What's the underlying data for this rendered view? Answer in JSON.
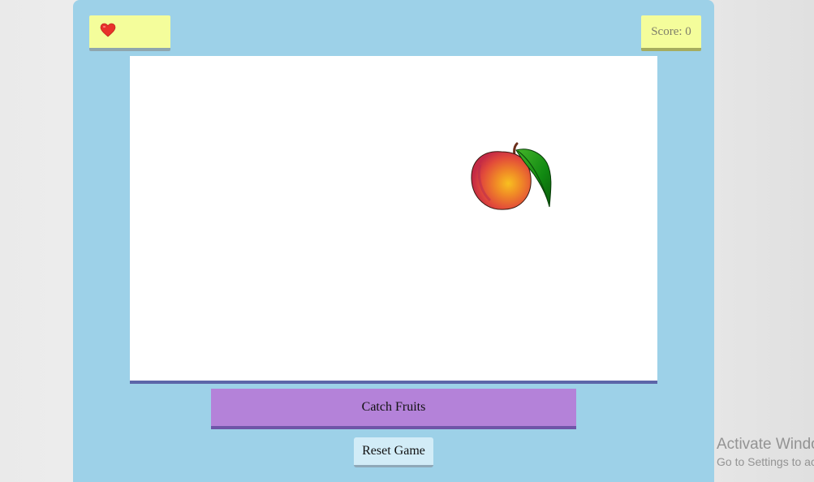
{
  "hud": {
    "lives_icons": [
      "heart-icon"
    ],
    "score_label": "Score:",
    "score_value": "0"
  },
  "play_area": {
    "falling_items": [
      "peach"
    ]
  },
  "controls": {
    "catch_label": "Catch Fruits",
    "reset_label": "Reset Game"
  },
  "watermark": {
    "title": "Activate Windows",
    "subtitle": "Go to Settings to activate Windows."
  },
  "colors": {
    "panel_bg": "#9dd1e8",
    "hud_bg": "#f4fd9b",
    "catch_button": "#b482d9",
    "reset_button": "#d2ecf7",
    "play_area_border": "#5c65a8"
  }
}
